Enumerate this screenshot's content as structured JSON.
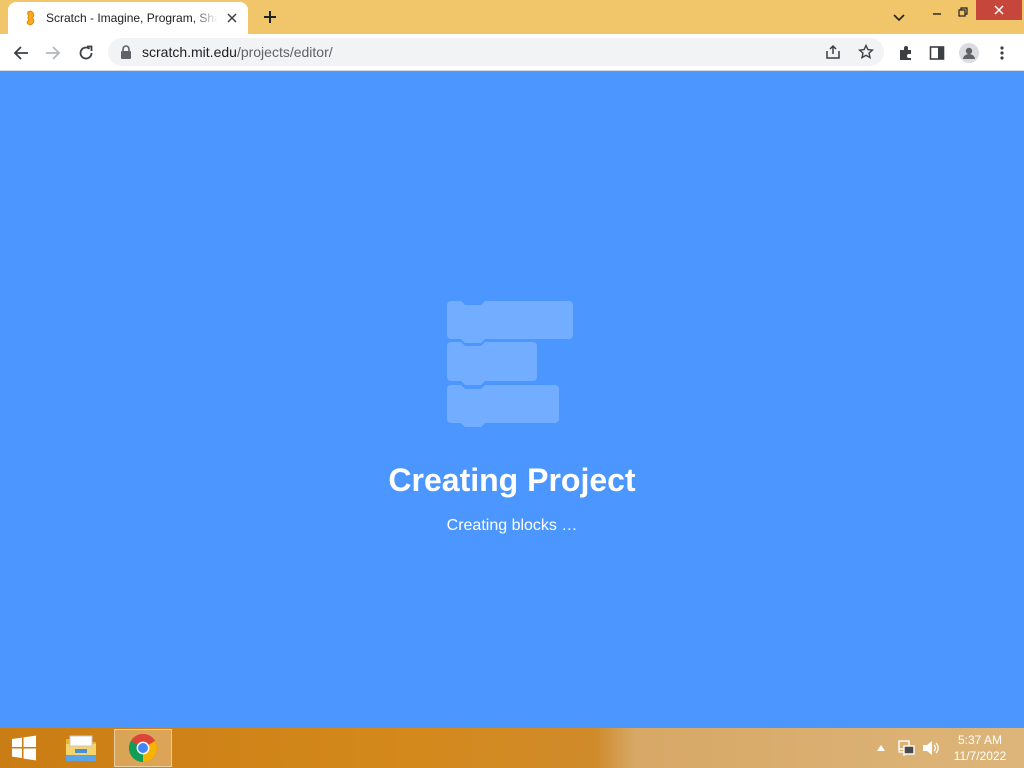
{
  "browser": {
    "tab": {
      "title": "Scratch - Imagine, Program, Share",
      "favicon": "scratch-cat-icon"
    },
    "new_tab_icon": "plus-icon",
    "window_controls": [
      "chevron-down-icon",
      "minimize-icon",
      "restore-icon",
      "close-icon"
    ],
    "nav": {
      "back_icon": "arrow-left-icon",
      "forward_icon": "arrow-right-icon",
      "reload_icon": "reload-icon"
    },
    "address": {
      "host": "scratch.mit.edu",
      "path": "/projects/editor/",
      "lock_icon": "lock-icon"
    },
    "toolbar_icons": [
      "share-icon",
      "star-icon",
      "extensions-icon",
      "side-panel-icon",
      "profile-icon",
      "more-vert-icon"
    ]
  },
  "page": {
    "background": "#4c97ff",
    "loading_title": "Creating Project",
    "loading_message": "Creating blocks …",
    "illustration": "scratch-blocks-icon"
  },
  "taskbar": {
    "clock_time": "5:37 AM",
    "clock_date": "11/7/2022",
    "items": [
      "windows-start-icon",
      "file-explorer-icon",
      "chrome-icon"
    ],
    "tray_icons": [
      "tray-up-arrow-icon",
      "network-icon",
      "volume-icon"
    ]
  }
}
